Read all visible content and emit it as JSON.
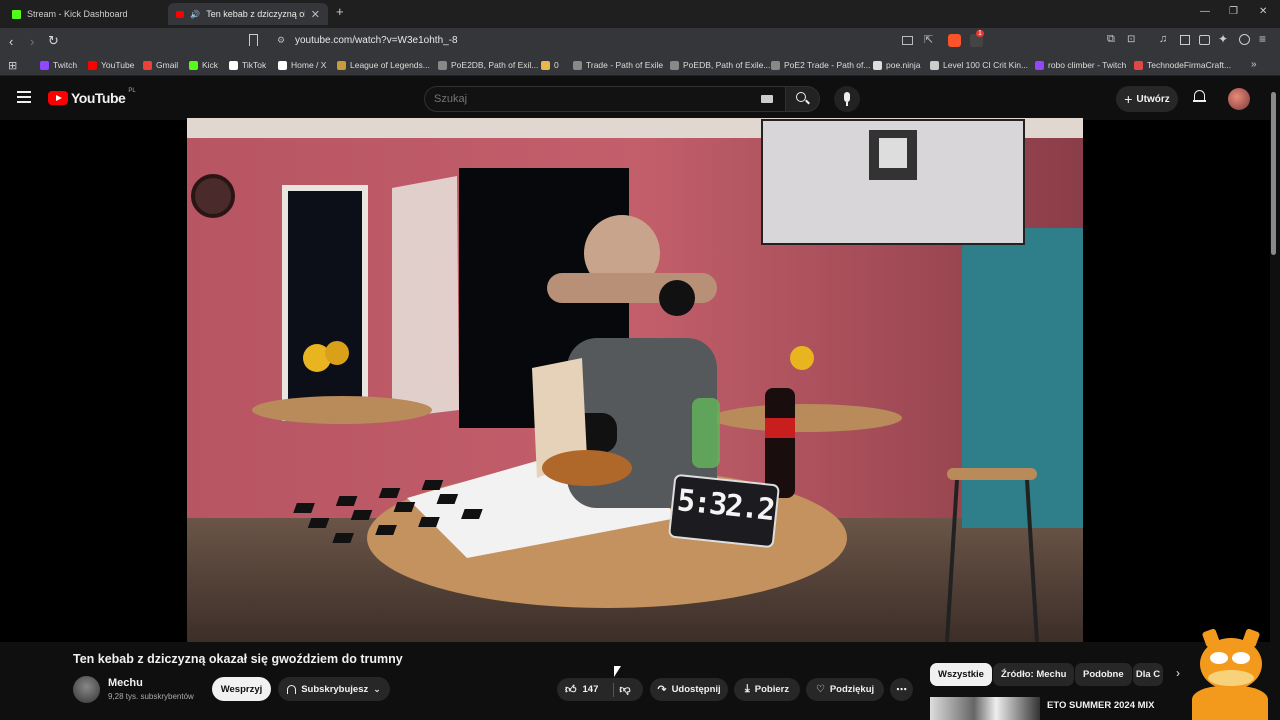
{
  "browser": {
    "tabs": [
      {
        "title": "Stream - Kick Dashboard",
        "active": false
      },
      {
        "title": "Ten kebab z dziczyzną okazał",
        "active": true
      }
    ],
    "new_tab": "+",
    "url": "youtube.com/watch?v=W3e1ohth_-8",
    "extension_badge": "1",
    "bookmarks": [
      {
        "label": "Twitch",
        "color": "#9146ff"
      },
      {
        "label": "YouTube",
        "color": "#ff0000"
      },
      {
        "label": "Gmail",
        "color": "#ea4335"
      },
      {
        "label": "Kick",
        "color": "#53fc18"
      },
      {
        "label": "TikTok",
        "color": "#ffffff"
      },
      {
        "label": "Home / X",
        "color": "#ffffff"
      },
      {
        "label": "League of Legends...",
        "color": "#c89b3c"
      },
      {
        "label": "PoE2DB, Path of Exil...",
        "color": "#888888"
      },
      {
        "label": "0",
        "color": "#e8b949"
      },
      {
        "label": "Trade - Path of Exile",
        "color": "#888888"
      },
      {
        "label": "PoEDB, Path of Exile...",
        "color": "#888888"
      },
      {
        "label": "PoE2 Trade - Path of...",
        "color": "#888888"
      },
      {
        "label": "poe.ninja",
        "color": "#dddddd"
      },
      {
        "label": "Level 100 CI Crit Kin...",
        "color": "#cccccc"
      },
      {
        "label": "robo climber - Twitch",
        "color": "#9146ff"
      },
      {
        "label": "TechnodeFirmaCraft...",
        "color": "#e04848"
      }
    ]
  },
  "youtube": {
    "logo_text": "YouTube",
    "region": "PL",
    "search_placeholder": "Szukaj",
    "create_label": "Utwórz",
    "brand_color": "#ff0000"
  },
  "video": {
    "timer_overlay": "5:32.2",
    "title": "Ten kebab z dziczyzną okazał się gwoździem do trumny",
    "channel": "Mechu",
    "subscribers": "9,28 tys. subskrybentów",
    "support_label": "Wesprzyj",
    "subscribed_label": "Subskrybujesz",
    "likes": "147",
    "share_label": "Udostępnij",
    "download_label": "Pobierz",
    "thanks_label": "Podziękuj"
  },
  "sidebar": {
    "chips": [
      "Wszystkie",
      "Źródło: Mechu",
      "Podobne",
      "Dla C"
    ],
    "recommendation_title": "ETO SUMMER 2024 MIX"
  }
}
